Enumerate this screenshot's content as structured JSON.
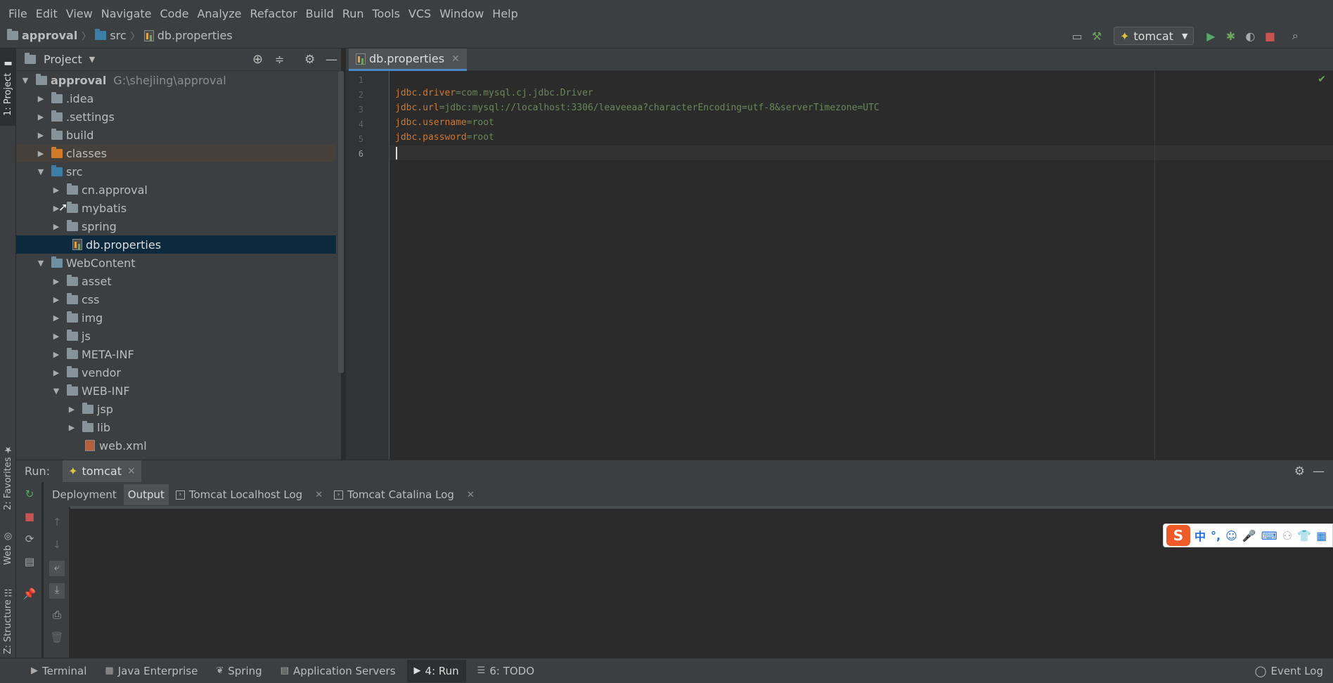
{
  "menu": [
    "File",
    "Edit",
    "View",
    "Navigate",
    "Code",
    "Analyze",
    "Refactor",
    "Build",
    "Run",
    "Tools",
    "VCS",
    "Window",
    "Help"
  ],
  "breadcrumb": {
    "project": "approval",
    "folder": "src",
    "file": "db.properties"
  },
  "run_config": "tomcat",
  "left_stripe": {
    "project": "1: Project",
    "favorites": "2: Favorites",
    "web": "Web",
    "structure": "Z: Structure"
  },
  "project_panel": {
    "title": "Project",
    "tree": [
      {
        "label": "approval",
        "hint": "G:\\shejiing\\approval",
        "depth": 0,
        "expanded": true,
        "icon": "module-folder"
      },
      {
        "label": ".idea",
        "depth": 1,
        "expanded": false,
        "icon": "folder"
      },
      {
        "label": ".settings",
        "depth": 1,
        "expanded": false,
        "icon": "folder"
      },
      {
        "label": "build",
        "depth": 1,
        "expanded": false,
        "icon": "folder"
      },
      {
        "label": "classes",
        "depth": 1,
        "expanded": false,
        "icon": "excluded-folder"
      },
      {
        "label": "src",
        "depth": 1,
        "expanded": true,
        "icon": "source-folder"
      },
      {
        "label": "cn.approval",
        "depth": 2,
        "expanded": false,
        "icon": "package"
      },
      {
        "label": "mybatis",
        "depth": 2,
        "expanded": false,
        "icon": "package"
      },
      {
        "label": "spring",
        "depth": 2,
        "expanded": false,
        "icon": "package"
      },
      {
        "label": "db.properties",
        "depth": 2,
        "icon": "properties-file"
      },
      {
        "label": "WebContent",
        "depth": 1,
        "expanded": true,
        "icon": "web-folder"
      },
      {
        "label": "asset",
        "depth": 2,
        "expanded": false,
        "icon": "folder"
      },
      {
        "label": "css",
        "depth": 2,
        "expanded": false,
        "icon": "folder"
      },
      {
        "label": "img",
        "depth": 2,
        "expanded": false,
        "icon": "folder"
      },
      {
        "label": "js",
        "depth": 2,
        "expanded": false,
        "icon": "folder"
      },
      {
        "label": "META-INF",
        "depth": 2,
        "expanded": false,
        "icon": "folder"
      },
      {
        "label": "vendor",
        "depth": 2,
        "expanded": false,
        "icon": "folder"
      },
      {
        "label": "WEB-INF",
        "depth": 2,
        "expanded": true,
        "icon": "folder"
      },
      {
        "label": "jsp",
        "depth": 3,
        "expanded": false,
        "icon": "folder"
      },
      {
        "label": "lib",
        "depth": 3,
        "expanded": false,
        "icon": "folder"
      },
      {
        "label": "web.xml",
        "depth": 3,
        "icon": "xml-file"
      }
    ]
  },
  "editor": {
    "tab": "db.properties",
    "line_numbers": [
      "1",
      "2",
      "3",
      "4",
      "5",
      "6"
    ],
    "lines": [
      {
        "key": "",
        "val": ""
      },
      {
        "key": "jdbc.driver",
        "val": "=com.mysql.cj.jdbc.Driver"
      },
      {
        "key": "jdbc.url",
        "val": "=jdbc:mysql://localhost:3306/leaveeaa?characterEncoding=utf-8&serverTimezone=UTC"
      },
      {
        "key": "jdbc.username",
        "val": "=root"
      },
      {
        "key": "jdbc.password",
        "val": "=root"
      },
      {
        "key": "",
        "val": ""
      }
    ]
  },
  "run_panel": {
    "label": "Run:",
    "tab": "tomcat",
    "subtabs": [
      "Deployment",
      "Output",
      "Tomcat Localhost Log",
      "Tomcat Catalina Log"
    ]
  },
  "ime": {
    "logo": "S",
    "lang": "中"
  },
  "bottom_tabs": [
    "Terminal",
    "Java Enterprise",
    "Spring",
    "Application Servers",
    "4: Run",
    "6: TODO"
  ],
  "event_log": "Event Log",
  "colors": {
    "key": "#cc7832",
    "value": "#6a8759",
    "selection": "#0d293e",
    "accent": "#4a88c7"
  }
}
